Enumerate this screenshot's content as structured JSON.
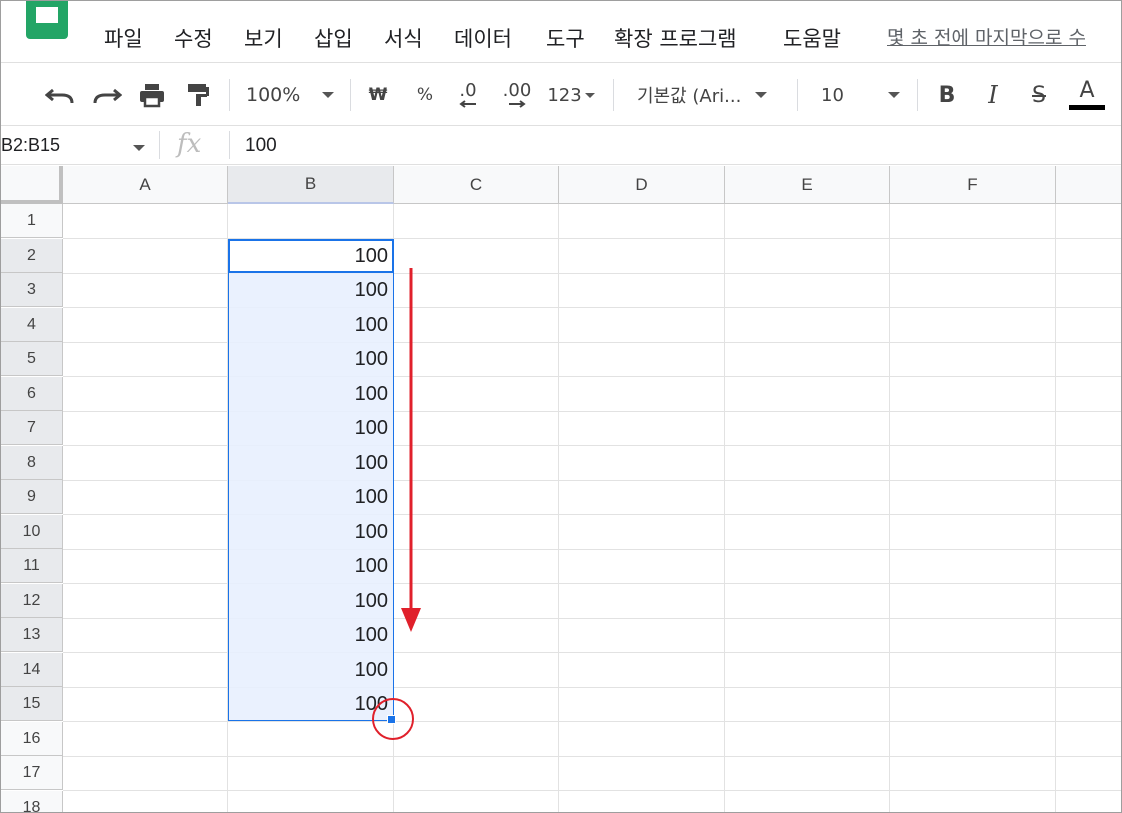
{
  "menu": {
    "items": [
      "파일",
      "수정",
      "보기",
      "삽입",
      "서식",
      "데이터",
      "도구",
      "확장 프로그램",
      "도움말"
    ],
    "last_edit": "몇 초 전에 마지막으로 수"
  },
  "toolbar": {
    "zoom": "100%",
    "currency": "₩",
    "percent": "%",
    "decrease_decimal": ".0",
    "increase_decimal": ".00",
    "more_formats": "123",
    "font": "기본값 (Ari...",
    "font_size": "10",
    "bold": "B",
    "italic": "I",
    "strikethrough": "S",
    "text_color": "A"
  },
  "formula_bar": {
    "name_box": "B2:B15",
    "fx": "fx",
    "value": "100"
  },
  "sheet": {
    "columns": [
      "A",
      "B",
      "C",
      "D",
      "E",
      "F"
    ],
    "rows": [
      "1",
      "2",
      "3",
      "4",
      "5",
      "6",
      "7",
      "8",
      "9",
      "10",
      "11",
      "12",
      "13",
      "14",
      "15",
      "16",
      "17",
      "18"
    ],
    "column_b_values": [
      "100",
      "100",
      "100",
      "100",
      "100",
      "100",
      "100",
      "100",
      "100",
      "100",
      "100",
      "100",
      "100",
      "100"
    ],
    "selection": "B2:B15"
  },
  "colors": {
    "accent": "#1a73e8",
    "annotation_red": "#e0202b",
    "logo_green": "#23a566"
  },
  "icons": [
    "sheets-logo-icon",
    "undo-icon",
    "redo-icon",
    "print-icon",
    "paint-format-icon",
    "chevron-down-icon",
    "fill-handle-icon",
    "drag-arrow-icon"
  ]
}
